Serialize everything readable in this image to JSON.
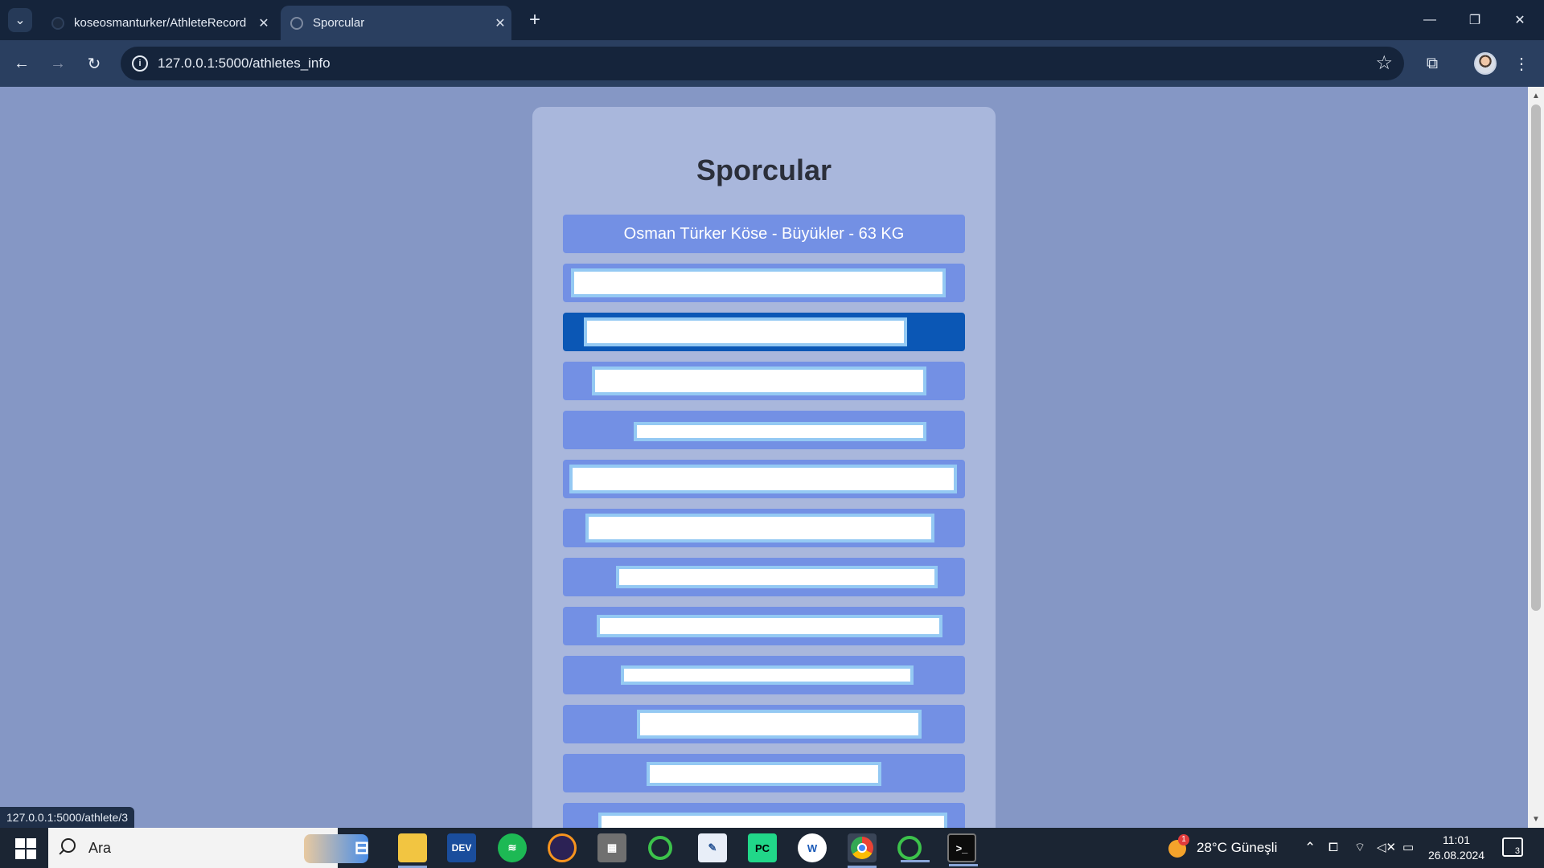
{
  "browser": {
    "tabs": [
      {
        "title": "koseosmanturker/AthleteRecord",
        "active": false
      },
      {
        "title": "Sporcular",
        "active": true
      }
    ],
    "url": "127.0.0.1:5000/athletes_info",
    "status_url": "127.0.0.1:5000/athlete/3"
  },
  "page": {
    "heading": "Sporcular",
    "athletes": [
      {
        "label": "Osman Türker Köse - Büyükler - 63 KG",
        "redacted": false
      },
      {
        "label": "",
        "redacted": true
      },
      {
        "label": "",
        "redacted": true,
        "active": true
      },
      {
        "label": "",
        "redacted": true
      },
      {
        "label": "",
        "redacted": true
      },
      {
        "label": "",
        "redacted": true
      },
      {
        "label": "",
        "redacted": true
      },
      {
        "label": "",
        "redacted": true
      },
      {
        "label": "",
        "redacted": true
      },
      {
        "label": "",
        "redacted": true
      },
      {
        "label": "",
        "redacted": true
      },
      {
        "label": "",
        "redacted": true
      },
      {
        "label": "",
        "redacted": true
      }
    ]
  },
  "taskbar": {
    "search_placeholder": "Ara",
    "weather": "28°C  Güneşli",
    "weather_badge": "1",
    "time": "11:01",
    "date": "26.08.2024",
    "notifications": "3",
    "apps": [
      "task-view",
      "file-explorer",
      "devtoys",
      "spotify",
      "eclipse",
      "calculator",
      "loader",
      "notepad",
      "pycharm",
      "app-w",
      "chrome",
      "loader-2",
      "terminal"
    ]
  },
  "colors": {
    "page_bg": "#8597c5",
    "card_bg": "#a9b7dc",
    "row_bg": "#7390e4",
    "row_active_bg": "#0b57b5",
    "redaction_border": "#94c9f3"
  }
}
